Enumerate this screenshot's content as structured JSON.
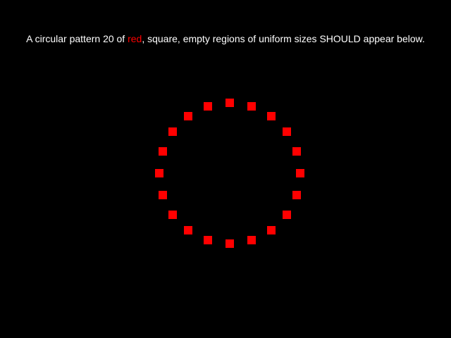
{
  "instruction": {
    "prefix": "A circular pattern 20 of ",
    "highlight": "red",
    "suffix": ", square, empty regions of uniform sizes SHOULD appear below."
  },
  "pattern": {
    "count": 20,
    "shape": "square",
    "arrangement": "circle"
  },
  "colors": {
    "background": "#000000",
    "text": "#ffffff",
    "accent": "#ff0000"
  }
}
